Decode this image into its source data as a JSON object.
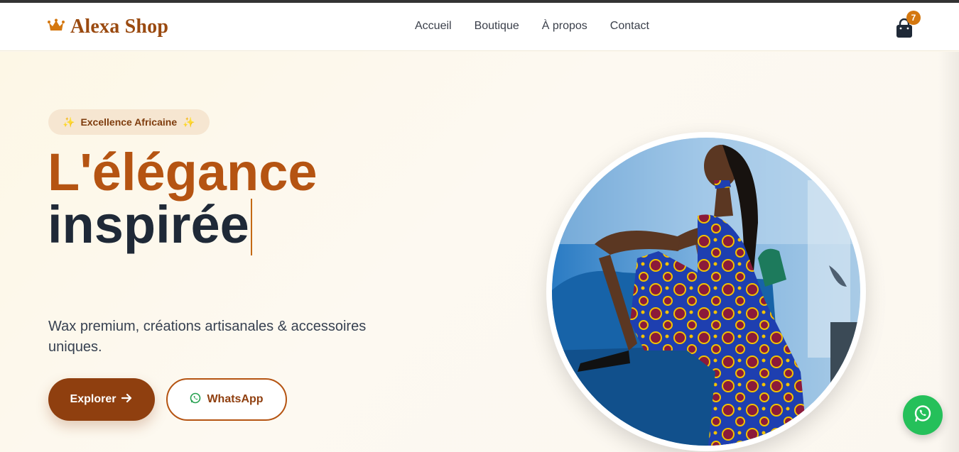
{
  "brand": {
    "name": "Alexa Shop",
    "icon": "crown-icon",
    "color": "#9a4a10"
  },
  "nav": {
    "items": [
      {
        "label": "Accueil"
      },
      {
        "label": "Boutique"
      },
      {
        "label": "À propos"
      },
      {
        "label": "Contact"
      }
    ]
  },
  "cart": {
    "icon": "shopping-bag-icon",
    "count": "7"
  },
  "hero": {
    "badge": "Excellence Africaine",
    "badge_icon": "sparkles-icon",
    "title_line1": "L'élégance",
    "title_line2": "inspirée",
    "subtitle": "Wax premium, créations artisanales & accessoires uniques.",
    "explore_label": "Explorer",
    "whatsapp_label": "WhatsApp",
    "image_alt": "woman-in-wax-dress-photo"
  },
  "colors": {
    "accent": "#b55412",
    "accent_dark": "#8f3f0f",
    "whatsapp": "#25c05a",
    "text_dark": "#1f2937"
  }
}
